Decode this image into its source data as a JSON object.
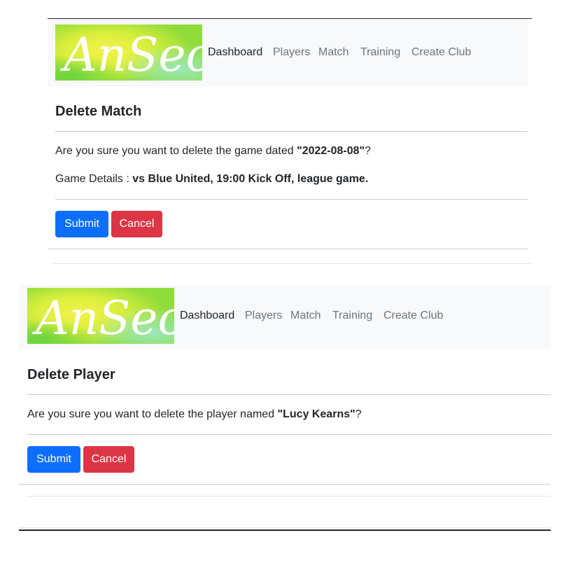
{
  "brand": {
    "logo_text": "AnSeo"
  },
  "nav": [
    "Dashboard",
    "Players",
    "Match",
    "Training",
    "Create Club"
  ],
  "colors": {
    "navbar_bg": "#f8f9fa",
    "submit": "#0d6efd",
    "cancel": "#dc3545",
    "active_link": "#212529",
    "link": "#6c757d"
  },
  "match_panel": {
    "title": "Delete Match",
    "question_prefix": "Are you sure you want to delete the game dated ",
    "date": "\"2022-08-08\"",
    "question_suffix": "?",
    "details_label": "Game Details : ",
    "details_value": "vs Blue United, 19:00 Kick Off, league game.",
    "submit_label": "Submit",
    "cancel_label": "Cancel"
  },
  "player_panel": {
    "title": "Delete Player",
    "question_prefix": "Are you sure you want to delete the player named ",
    "player_name": "\"Lucy Kearns\"",
    "question_suffix": "?",
    "submit_label": "Submit",
    "cancel_label": "Cancel"
  }
}
